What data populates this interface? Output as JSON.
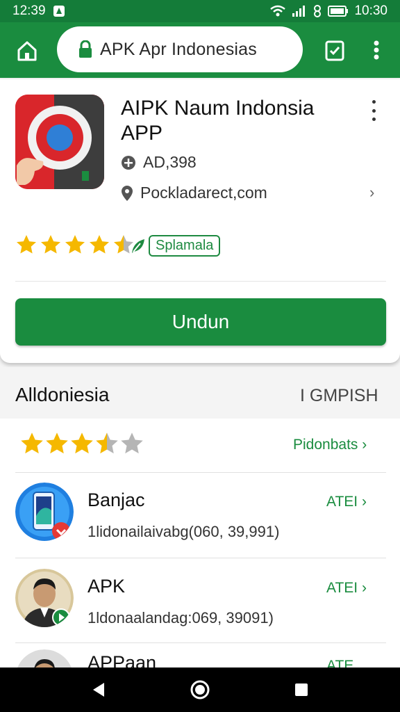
{
  "status_bar": {
    "time": "12:39",
    "clock_right": "10:30"
  },
  "browser": {
    "url": "APK Apr Indonesias"
  },
  "app": {
    "title_line1": "AIPK Naum Indonsia",
    "title_line2": "APP",
    "size": "AD,398",
    "developer": "Pockladarect,com",
    "rating": 4.5,
    "badge": "Splamala",
    "download_label": "Undun"
  },
  "section": {
    "title": "Alldoniesia",
    "action": "I GMPISH"
  },
  "list": {
    "rating": 3.5,
    "more_label": "Pidonbats",
    "items": [
      {
        "name": "Banjac",
        "sub": "1lidonailaivabg(060, 39,991)",
        "action": "ATEI"
      },
      {
        "name": "APK",
        "sub": "1ldonaalandag:069, 39091)",
        "action": "ATEI"
      },
      {
        "name": "APPaan",
        "sub": "",
        "action": "ATE"
      }
    ]
  },
  "colors": {
    "primary": "#1a8c3f",
    "status_bar": "#147c39",
    "star": "#f5b800",
    "icon_red": "#d9262b"
  },
  "icons": [
    "home-icon",
    "lock-icon",
    "tab-switcher-icon",
    "more-vert-icon",
    "shield-icon",
    "location-pin-icon",
    "star-icon",
    "back-icon",
    "home-circle-icon",
    "recents-icon"
  ]
}
